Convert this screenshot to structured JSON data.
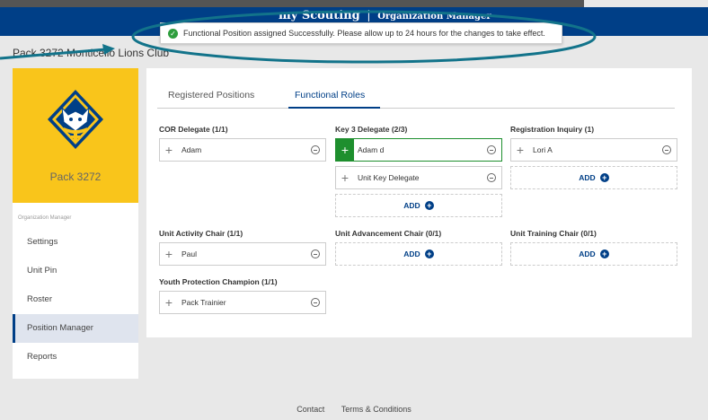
{
  "header": {
    "brand": "my Scouting",
    "separator": "|",
    "subtitle": "Organization Manager"
  },
  "toast": {
    "message": "Functional Position assigned Successfully. Please allow up to 24 hours for the changes to take effect."
  },
  "unit_title": "Pack 3272 Monticello Lions Club",
  "sidebar": {
    "pack_name": "Pack 3272",
    "caption": "Organization Manager",
    "items": [
      {
        "label": "Settings"
      },
      {
        "label": "Unit Pin"
      },
      {
        "label": "Roster"
      },
      {
        "label": "Position Manager"
      },
      {
        "label": "Reports"
      }
    ]
  },
  "tabs": [
    {
      "label": "Registered Positions"
    },
    {
      "label": "Functional Roles"
    }
  ],
  "roles": [
    {
      "title": "COR Delegate (1/1)",
      "members": [
        "Adam"
      ],
      "add_label": ""
    },
    {
      "title": "Key 3 Delegate (2/3)",
      "members": [
        "Adam d",
        "Unit Key Delegate"
      ],
      "add_label": "ADD"
    },
    {
      "title": "Registration Inquiry (1)",
      "members": [
        "Lori A"
      ],
      "add_label": "ADD"
    },
    {
      "title": "Unit Activity Chair (1/1)",
      "members": [
        "Paul"
      ],
      "add_label": ""
    },
    {
      "title": "Unit Advancement Chair (0/1)",
      "members": [],
      "add_label": "ADD"
    },
    {
      "title": "Unit Training Chair (0/1)",
      "members": [],
      "add_label": "ADD"
    },
    {
      "title": "Youth Protection Champion (1/1)",
      "members": [
        "Pack Trainier"
      ],
      "add_label": ""
    }
  ],
  "footer": {
    "links": [
      "Contact",
      "Terms & Conditions"
    ]
  },
  "colors": {
    "brand_blue": "#003f87",
    "cub_yellow": "#f9c51b",
    "success_green": "#2e9e3e",
    "annotation_teal": "#12738a"
  },
  "icons": {
    "toast": "check-circle-icon",
    "slot_add": "plus-icon",
    "slot_remove": "minus-circle-icon",
    "add_button": "plus-circle-icon"
  }
}
